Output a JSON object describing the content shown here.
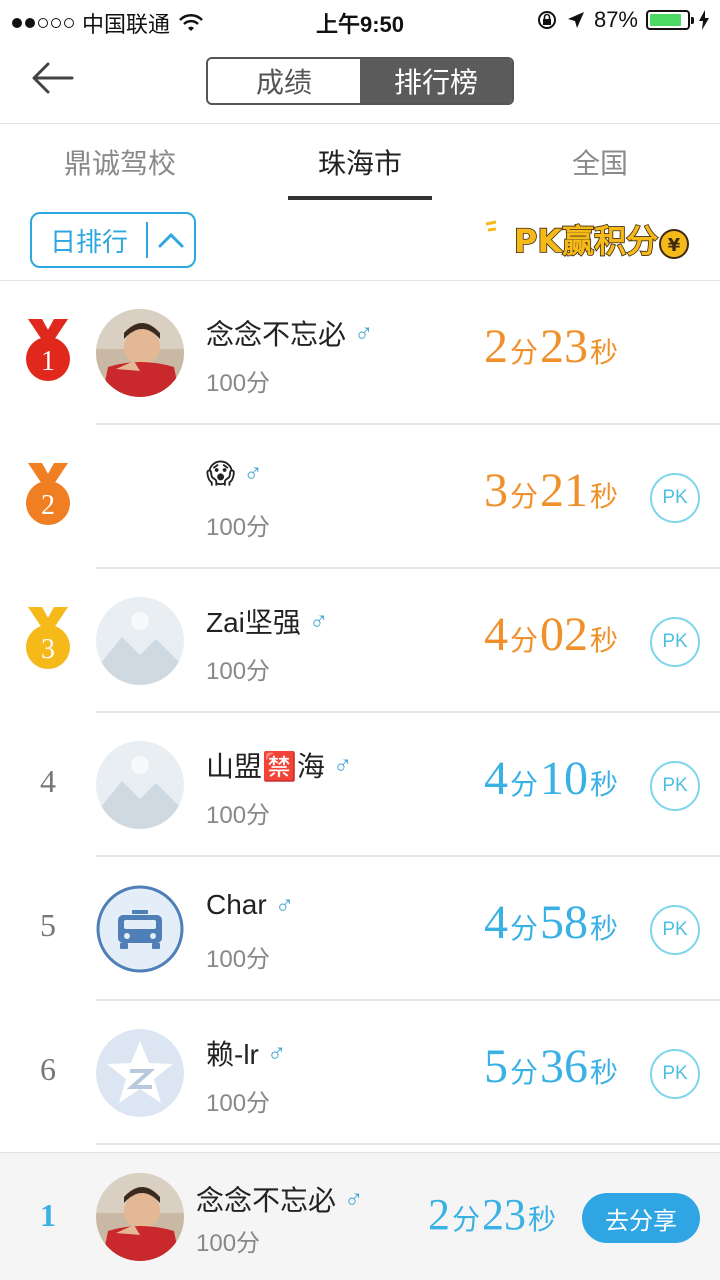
{
  "status_bar": {
    "carrier": "中国联通",
    "time": "上午9:50",
    "battery": "87%",
    "battery_level": 0.87
  },
  "nav": {
    "back_icon": "back-arrow-icon",
    "segments": [
      "成绩",
      "排行榜"
    ],
    "active_segment": 1
  },
  "tabs": [
    {
      "label": "鼎诚驾校",
      "active": false
    },
    {
      "label": "珠海市",
      "active": true
    },
    {
      "label": "全国",
      "active": false
    }
  ],
  "filter": {
    "label": "日排行",
    "icon": "chevron-up-icon"
  },
  "promo": {
    "text": "PK赢积分",
    "coin": "¥"
  },
  "colors": {
    "accent": "#2ea7e0",
    "orange": "#f0902b",
    "gold": "#f6b91a",
    "red": "#e0281c",
    "bar": "#5b5b5b"
  },
  "rows": [
    {
      "rank": "1",
      "badge": "red",
      "name": "念念不忘必",
      "gender": "♂",
      "points": "100分",
      "min": "2",
      "min_unit": "分",
      "sec": "23",
      "sec_unit": "秒",
      "pk": ""
    },
    {
      "rank": "2",
      "badge": "orange",
      "name": "😱",
      "gender": "♂",
      "points": "100分",
      "min": "3",
      "min_unit": "分",
      "sec": "21",
      "sec_unit": "秒",
      "pk": "PK"
    },
    {
      "rank": "3",
      "badge": "gold",
      "name": "Zai坚强",
      "gender": "♂",
      "points": "100分",
      "min": "4",
      "min_unit": "分",
      "sec": "02",
      "sec_unit": "秒",
      "pk": "PK"
    },
    {
      "rank": "4",
      "badge": "",
      "name": "山盟🈲海",
      "gender": "♂",
      "points": "100分",
      "min": "4",
      "min_unit": "分",
      "sec": "10",
      "sec_unit": "秒",
      "pk": "PK"
    },
    {
      "rank": "5",
      "badge": "",
      "name": "Char",
      "gender": "♂",
      "points": "100分",
      "min": "4",
      "min_unit": "分",
      "sec": "58",
      "sec_unit": "秒",
      "pk": "PK"
    },
    {
      "rank": "6",
      "badge": "",
      "name": "赖-lr",
      "gender": "♂",
      "points": "100分",
      "min": "5",
      "min_unit": "分",
      "sec": "36",
      "sec_unit": "秒",
      "pk": "PK"
    }
  ],
  "me": {
    "rank": "1",
    "name": "念念不忘必",
    "gender": "♂",
    "points": "100分",
    "min": "2",
    "min_unit": "分",
    "sec": "23",
    "sec_unit": "秒",
    "share_label": "去分享"
  }
}
